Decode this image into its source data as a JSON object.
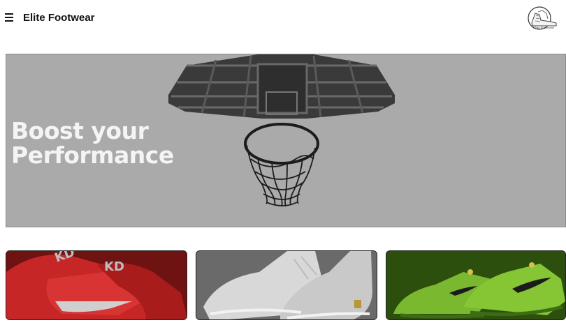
{
  "header": {
    "menu_icon": "hamburger-menu-icon",
    "brand": "Elite Footwear",
    "logo_text": "Elite Footwear"
  },
  "hero": {
    "title_line1": "Boost your",
    "title_line2": "Performance",
    "image": "basketball-hoop-photo"
  },
  "cards": [
    {
      "image": "red-basketball-shoe-photo",
      "accent": "#d42a2a"
    },
    {
      "image": "white-basketball-shoe-photo",
      "accent": "#e6e6e6"
    },
    {
      "image": "green-basketball-shoe-photo",
      "accent": "#7bc233"
    }
  ]
}
